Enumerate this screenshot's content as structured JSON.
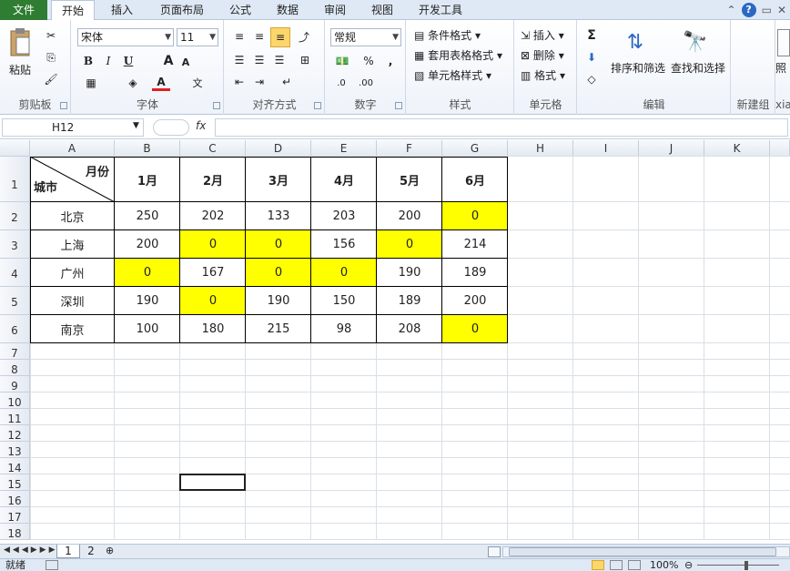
{
  "ribbon_tabs": [
    "文件",
    "开始",
    "插入",
    "页面布局",
    "公式",
    "数据",
    "审阅",
    "视图",
    "开发工具"
  ],
  "active_tab": "开始",
  "clipboard": {
    "paste": "粘贴",
    "group": "剪贴板"
  },
  "font": {
    "name": "宋体",
    "size": "11",
    "bold": "B",
    "italic": "I",
    "underline": "U",
    "grow": "A",
    "shrink": "A",
    "group": "字体"
  },
  "alignment": {
    "group": "对齐方式"
  },
  "number": {
    "format": "常规",
    "percent": "%",
    "comma": ",",
    "inc": ".0",
    "dec": ".00",
    "group": "数字"
  },
  "styles": {
    "conditional": "条件格式",
    "table": "套用表格格式",
    "cell": "单元格样式",
    "group": "样式"
  },
  "cells": {
    "insert": "插入",
    "delete": "删除",
    "format": "格式",
    "group": "单元格"
  },
  "editing": {
    "sigma": "Σ",
    "sort": "排序和筛选",
    "find": "查找和选择",
    "group": "编辑"
  },
  "newgroup": {
    "group": "新建组",
    "photo": "照",
    "xia": "xia"
  },
  "formula_bar": {
    "cell_ref": "H12",
    "fx": "fx",
    "value": ""
  },
  "columns": [
    "A",
    "B",
    "C",
    "D",
    "E",
    "F",
    "G",
    "H",
    "I",
    "J",
    "K"
  ],
  "rows": [
    "1",
    "2",
    "3",
    "4",
    "5",
    "6",
    "7",
    "8",
    "9",
    "10",
    "11",
    "12",
    "13",
    "14",
    "15",
    "16",
    "17",
    "18"
  ],
  "table": {
    "corner_month": "月份",
    "corner_city": "城市",
    "months": [
      "1月",
      "2月",
      "3月",
      "4月",
      "5月",
      "6月"
    ],
    "data": [
      {
        "city": "北京",
        "values": [
          "250",
          "202",
          "133",
          "203",
          "200",
          "0"
        ]
      },
      {
        "city": "上海",
        "values": [
          "200",
          "0",
          "0",
          "156",
          "0",
          "214"
        ]
      },
      {
        "city": "广州",
        "values": [
          "0",
          "167",
          "0",
          "0",
          "190",
          "189"
        ]
      },
      {
        "city": "深圳",
        "values": [
          "190",
          "0",
          "190",
          "150",
          "189",
          "200"
        ]
      },
      {
        "city": "南京",
        "values": [
          "100",
          "180",
          "215",
          "98",
          "208",
          "0"
        ]
      }
    ],
    "highlight_color": "#ffff00"
  },
  "sheets": [
    "1",
    "2"
  ],
  "active_sheet": "1",
  "status": {
    "ready": "就绪",
    "zoom": "100%"
  }
}
